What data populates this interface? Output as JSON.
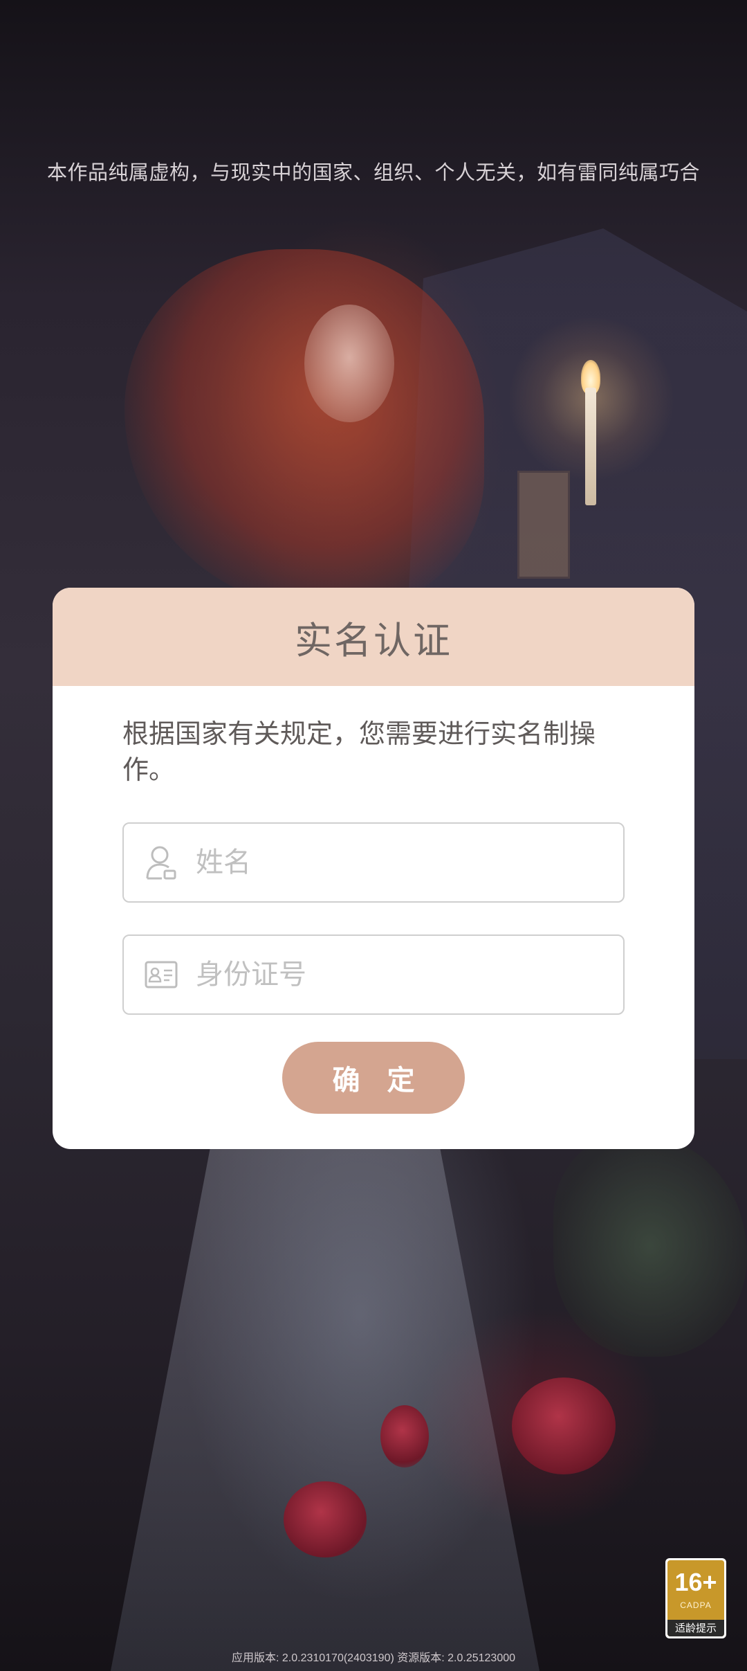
{
  "disclaimer": "本作品纯属虚构，与现实中的国家、组织、个人无关，如有雷同纯属巧合",
  "dialog": {
    "title": "实名认证",
    "message": "根据国家有关规定，您需要进行实名制操作。",
    "name_field": {
      "icon": "user-icon",
      "placeholder": "姓名",
      "value": ""
    },
    "id_field": {
      "icon": "id-card-icon",
      "placeholder": "身份证号",
      "value": ""
    },
    "confirm_label": "确 定"
  },
  "age_badge": {
    "rating": "16+",
    "org": "CADPA",
    "tip": "适龄提示"
  },
  "version_text": "应用版本: 2.0.2310170(2403190) 资源版本: 2.0.25123000",
  "colors": {
    "header_bg": "#f0d5c5",
    "button_bg": "#d4a590",
    "badge_bg": "#c8982a"
  }
}
